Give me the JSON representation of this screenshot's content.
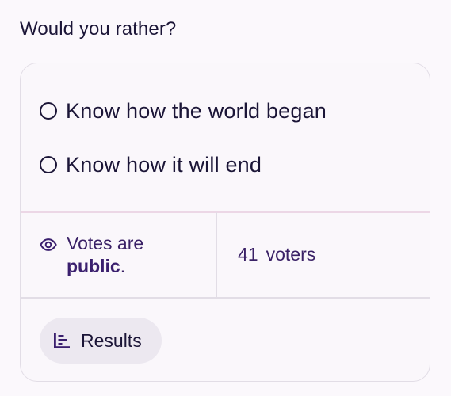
{
  "poll": {
    "question": "Would you rather?",
    "options": [
      {
        "label": "Know how the world began",
        "selected": false
      },
      {
        "label": "Know how it will end",
        "selected": false
      }
    ],
    "visibility": {
      "prefix": "Votes are",
      "value": "public",
      "suffix": "."
    },
    "voters": {
      "count": "41",
      "label": "voters"
    },
    "results_button": {
      "label": "Results"
    }
  },
  "icons": {
    "visibility": "eye-icon",
    "results": "bar-chart-icon"
  },
  "colors": {
    "background": "#fbf8fc",
    "text": "#1b1537",
    "accent": "#3a1f6e",
    "button_bg": "#ece8f0",
    "border": "#e2dde6"
  }
}
